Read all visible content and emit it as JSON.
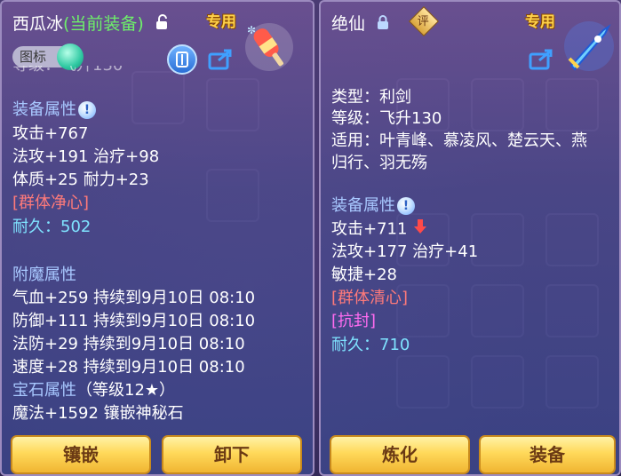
{
  "left": {
    "title_name": "西瓜冰",
    "title_status": "(当前装备)",
    "exclusive": "专用",
    "icon_toggle": "图标",
    "level_partial": "等级：飞升130",
    "equip_attr_header": "装备属性",
    "attrs": [
      "攻击+767",
      "法攻+191 治疗+98",
      "体质+25 耐力+23"
    ],
    "skill": "[群体净心]",
    "durability_label": "耐久：",
    "durability_value": "502",
    "enchant_header": "附魔属性",
    "enchants": [
      "气血+259 持续到9月10日 08:10",
      "防御+111 持续到9月10日 08:10",
      "法防+29 持续到9月10日 08:10",
      "速度+28 持续到9月10日 08:10"
    ],
    "gem_header": "宝石属性",
    "gem_level": "（等级12★）",
    "gem_text": "魔法+1592 镶嵌神秘石",
    "buttons": [
      "镶嵌",
      "卸下"
    ]
  },
  "right": {
    "title_name": "绝仙",
    "review_badge": "评",
    "exclusive": "专用",
    "type_line": "类型：利剑",
    "level_line": "等级：飞升130",
    "applies_line1": "适用：叶青峰、慕凌风、楚云天、燕",
    "applies_line2": "归行、羽无殇",
    "equip_attr_header": "装备属性",
    "attrs": [
      "攻击+711",
      "法攻+177 治疗+41",
      "敏捷+28"
    ],
    "skill1": "[群体清心]",
    "skill2": "[抗封]",
    "durability_label": "耐久：",
    "durability_value": "710",
    "buttons": [
      "炼化",
      "装备"
    ]
  },
  "colors": {
    "header": "#a8c8ff",
    "skill_red": "#ff7a7a",
    "durability": "#7fe3ff",
    "special_magenta": "#ff6cf0",
    "button_gold": "#ffd95a"
  },
  "icons": [
    "unlock-icon",
    "lock-icon",
    "compare-icon",
    "share-icon",
    "popsicle-weapon-icon",
    "blue-sword-icon",
    "info-icon",
    "down-arrow-icon"
  ]
}
